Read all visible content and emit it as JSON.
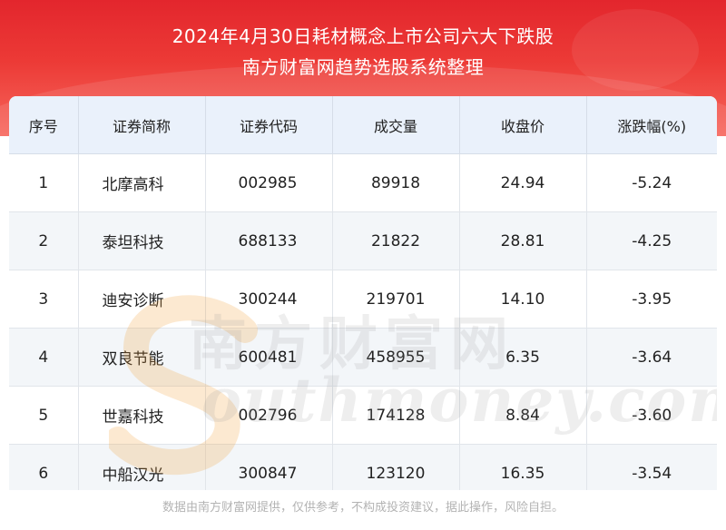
{
  "header": {
    "title": "2024年4月30日耗材概念上市公司六大下跌股",
    "subtitle": "南方财富网趋势选股系统整理"
  },
  "table": {
    "columns": [
      "序号",
      "证券简称",
      "证券代码",
      "成交量",
      "收盘价",
      "涨跌幅(%)"
    ],
    "rows": [
      [
        "1",
        "北摩高科",
        "002985",
        "89918",
        "24.94",
        "-5.24"
      ],
      [
        "2",
        "泰坦科技",
        "688133",
        "21822",
        "28.81",
        "-4.25"
      ],
      [
        "3",
        "迪安诊断",
        "300244",
        "219701",
        "14.10",
        "-3.95"
      ],
      [
        "4",
        "双良节能",
        "600481",
        "458955",
        "6.35",
        "-3.64"
      ],
      [
        "5",
        "世嘉科技",
        "002796",
        "174128",
        "8.84",
        "-3.60"
      ],
      [
        "6",
        "中船汉光",
        "300847",
        "123120",
        "16.35",
        "-3.54"
      ]
    ]
  },
  "watermark": {
    "cn": "南方财富网",
    "en": "outhmoney.com"
  },
  "footer": {
    "disclaimer": "数据由南方财富网提供，仅供参考，不构成投资建议，据此操作，风险自担。"
  },
  "colors": {
    "banner_red": "#e3262d",
    "header_row_bg": "#eaf1fb",
    "watermark_orange": "#f29a2e"
  }
}
